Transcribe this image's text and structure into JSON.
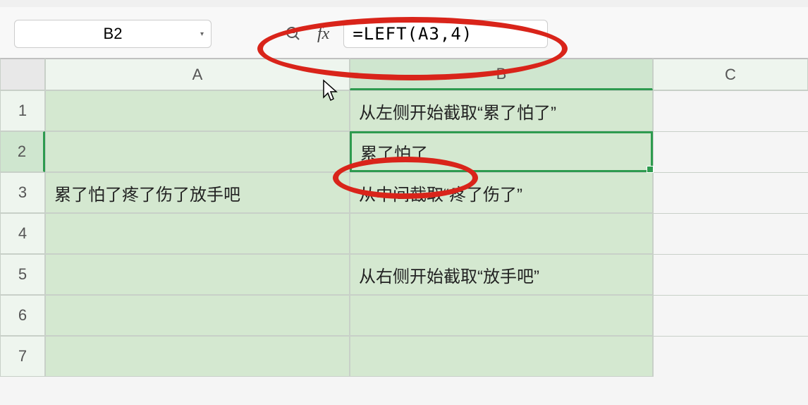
{
  "nameBox": "B2",
  "formula": "=LEFT(A3,4)",
  "fxLabel": "fx",
  "columns": [
    "A",
    "B",
    "C"
  ],
  "rows": [
    "1",
    "2",
    "3",
    "4",
    "5",
    "6",
    "7"
  ],
  "cells": {
    "A3": "累了怕了疼了伤了放手吧",
    "B1": "从左侧开始截取“累了怕了”",
    "B2": "累了怕了",
    "B3": "从中间截取“疼了伤了”",
    "B5": "从右侧开始截取“放手吧”"
  },
  "activeCell": "B2"
}
